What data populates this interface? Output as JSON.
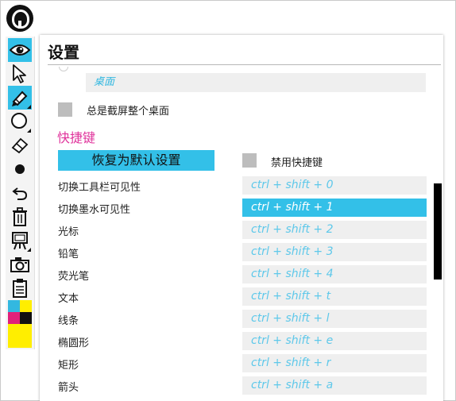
{
  "toolbar": {
    "tools": [
      "eye-icon",
      "cursor-icon",
      "pen-icon",
      "ellipse-icon",
      "eraser-icon",
      "dot-icon",
      "undo-icon",
      "trash-icon",
      "easel-icon",
      "camera-icon",
      "clipboard-icon"
    ],
    "palette": [
      "#33b8e0",
      "#ffee00",
      "#e0207a",
      "#111111",
      "#ffee00"
    ]
  },
  "settings": {
    "title": "设置",
    "desktop_field": "桌面",
    "capture_whole_desktop_label": "总是截屏整个桌面",
    "hotkeys_section": "快捷键",
    "reset_button": "恢复为默认设置",
    "disable_hotkeys_label": "禁用快捷键",
    "hotkeys": [
      {
        "label": "切换工具栏可见性",
        "key": "ctrl + shift + 0"
      },
      {
        "label": "切换墨水可见性",
        "key": "ctrl + shift + 1"
      },
      {
        "label": "光标",
        "key": "ctrl + shift + 2"
      },
      {
        "label": "铅笔",
        "key": "ctrl + shift + 3"
      },
      {
        "label": "荧光笔",
        "key": "ctrl + shift + 4"
      },
      {
        "label": "文本",
        "key": "ctrl + shift + t"
      },
      {
        "label": "线条",
        "key": "ctrl + shift + l"
      },
      {
        "label": "椭圆形",
        "key": "ctrl + shift + e"
      },
      {
        "label": "矩形",
        "key": "ctrl + shift + r"
      },
      {
        "label": "箭头",
        "key": "ctrl + shift + a"
      }
    ]
  }
}
